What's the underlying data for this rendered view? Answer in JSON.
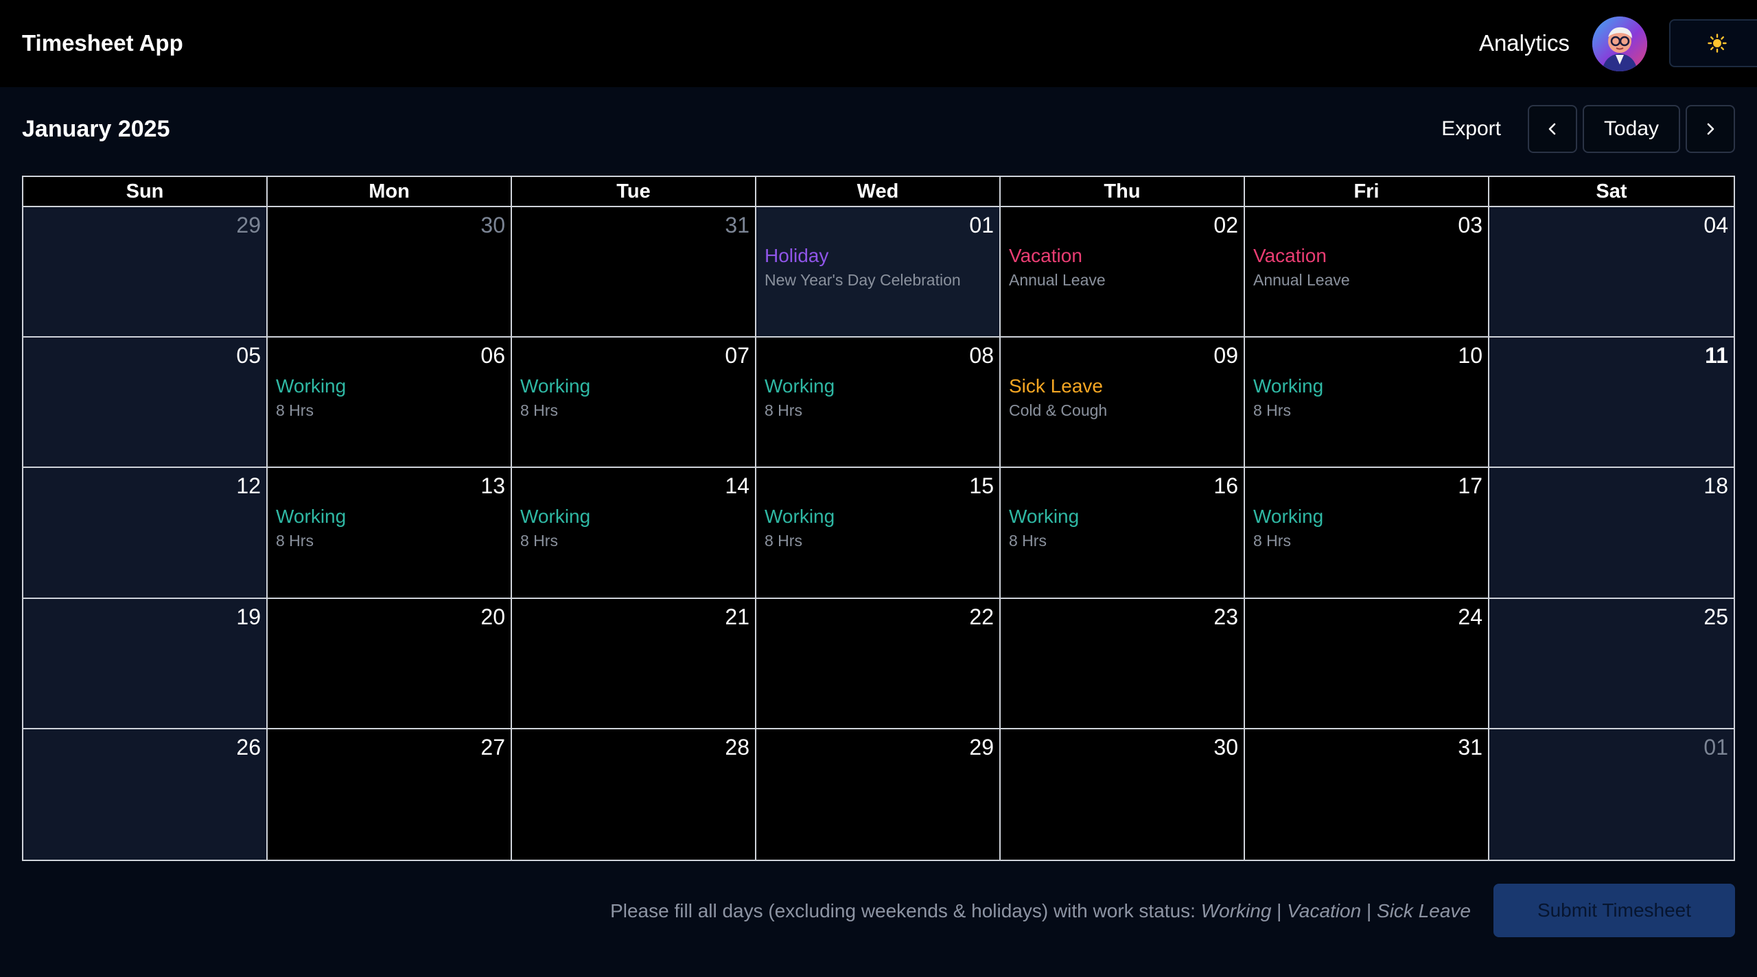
{
  "header": {
    "app_title": "Timesheet App",
    "analytics_label": "Analytics",
    "theme_icon": "☀️"
  },
  "toolbar": {
    "month_title": "January 2025",
    "export_label": "Export",
    "prev_icon": "‹",
    "today_label": "Today",
    "next_icon": "›"
  },
  "weekdays": [
    "Sun",
    "Mon",
    "Tue",
    "Wed",
    "Thu",
    "Fri",
    "Sat"
  ],
  "colors": {
    "working": "#2fb8a4",
    "holiday": "#8f55e8",
    "vacation": "#ea3d73",
    "sick": "#f5a623"
  },
  "weeks": [
    [
      {
        "day": "29",
        "muted": true,
        "weekend": true
      },
      {
        "day": "30",
        "muted": true
      },
      {
        "day": "31",
        "muted": true
      },
      {
        "day": "01",
        "highlight": true,
        "status": "Holiday",
        "kind": "holiday",
        "detail": "New Year's Day Celebration"
      },
      {
        "day": "02",
        "status": "Vacation",
        "kind": "vacation",
        "detail": "Annual Leave"
      },
      {
        "day": "03",
        "status": "Vacation",
        "kind": "vacation",
        "detail": "Annual Leave"
      },
      {
        "day": "04",
        "weekend": true
      }
    ],
    [
      {
        "day": "05",
        "weekend": true
      },
      {
        "day": "06",
        "status": "Working",
        "kind": "working",
        "detail": "8 Hrs"
      },
      {
        "day": "07",
        "status": "Working",
        "kind": "working",
        "detail": "8 Hrs"
      },
      {
        "day": "08",
        "status": "Working",
        "kind": "working",
        "detail": "8 Hrs"
      },
      {
        "day": "09",
        "status": "Sick Leave",
        "kind": "sick",
        "detail": "Cold & Cough"
      },
      {
        "day": "10",
        "status": "Working",
        "kind": "working",
        "detail": "8 Hrs"
      },
      {
        "day": "11",
        "weekend": true,
        "today": true
      }
    ],
    [
      {
        "day": "12",
        "weekend": true
      },
      {
        "day": "13",
        "status": "Working",
        "kind": "working",
        "detail": "8 Hrs"
      },
      {
        "day": "14",
        "status": "Working",
        "kind": "working",
        "detail": "8 Hrs"
      },
      {
        "day": "15",
        "status": "Working",
        "kind": "working",
        "detail": "8 Hrs"
      },
      {
        "day": "16",
        "status": "Working",
        "kind": "working",
        "detail": "8 Hrs"
      },
      {
        "day": "17",
        "status": "Working",
        "kind": "working",
        "detail": "8 Hrs"
      },
      {
        "day": "18",
        "weekend": true
      }
    ],
    [
      {
        "day": "19",
        "weekend": true
      },
      {
        "day": "20"
      },
      {
        "day": "21"
      },
      {
        "day": "22"
      },
      {
        "day": "23"
      },
      {
        "day": "24"
      },
      {
        "day": "25",
        "weekend": true
      }
    ],
    [
      {
        "day": "26",
        "weekend": true
      },
      {
        "day": "27"
      },
      {
        "day": "28"
      },
      {
        "day": "29"
      },
      {
        "day": "30"
      },
      {
        "day": "31"
      },
      {
        "day": "01",
        "weekend": true,
        "muted": true
      }
    ]
  ],
  "footer": {
    "note_prefix": "Please fill all days (excluding weekends & holidays) with work status: ",
    "status_working": "Working",
    "sep1": " | ",
    "status_vacation": "Vacation",
    "sep2": " | ",
    "status_sick": "Sick Leave",
    "submit_label": "Submit Timesheet"
  }
}
